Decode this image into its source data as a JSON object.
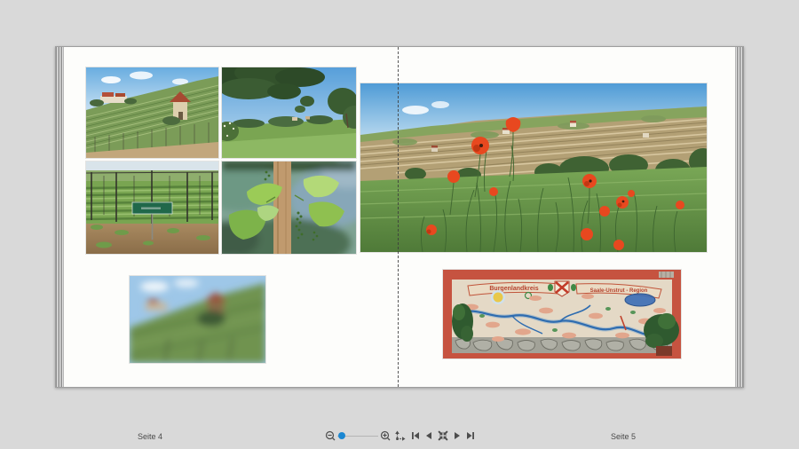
{
  "statusbar": {
    "left_page_label": "Seite 4",
    "right_page_label": "Seite 5"
  },
  "toolbar": {
    "icons": [
      "zoom-out-icon",
      "zoom-slider",
      "zoom-in-icon",
      "pan-icon",
      "first-page-icon",
      "previous-page-icon",
      "fit-view-icon",
      "next-page-icon",
      "last-page-icon"
    ],
    "accent_color": "#1b87d2",
    "icon_color": "#4d4d4d"
  },
  "book": {
    "left_page_number": 4,
    "right_page_number": 5,
    "photos": [
      "vineyard-hill-castle",
      "meadow-framed-by-trees",
      "vineyard-rows-sign",
      "grape-leaves-post",
      "poppy-field-panorama",
      "blurred-vineyard",
      "wall-mural-map"
    ],
    "mural": {
      "banner_left": "Burgenlandkreis",
      "banner_right": "Saale-Unstrut - Region"
    }
  },
  "colors": {
    "background": "#d9d9d9",
    "page": "#fdfdfb",
    "spine_dash": "#3d3d3d"
  }
}
